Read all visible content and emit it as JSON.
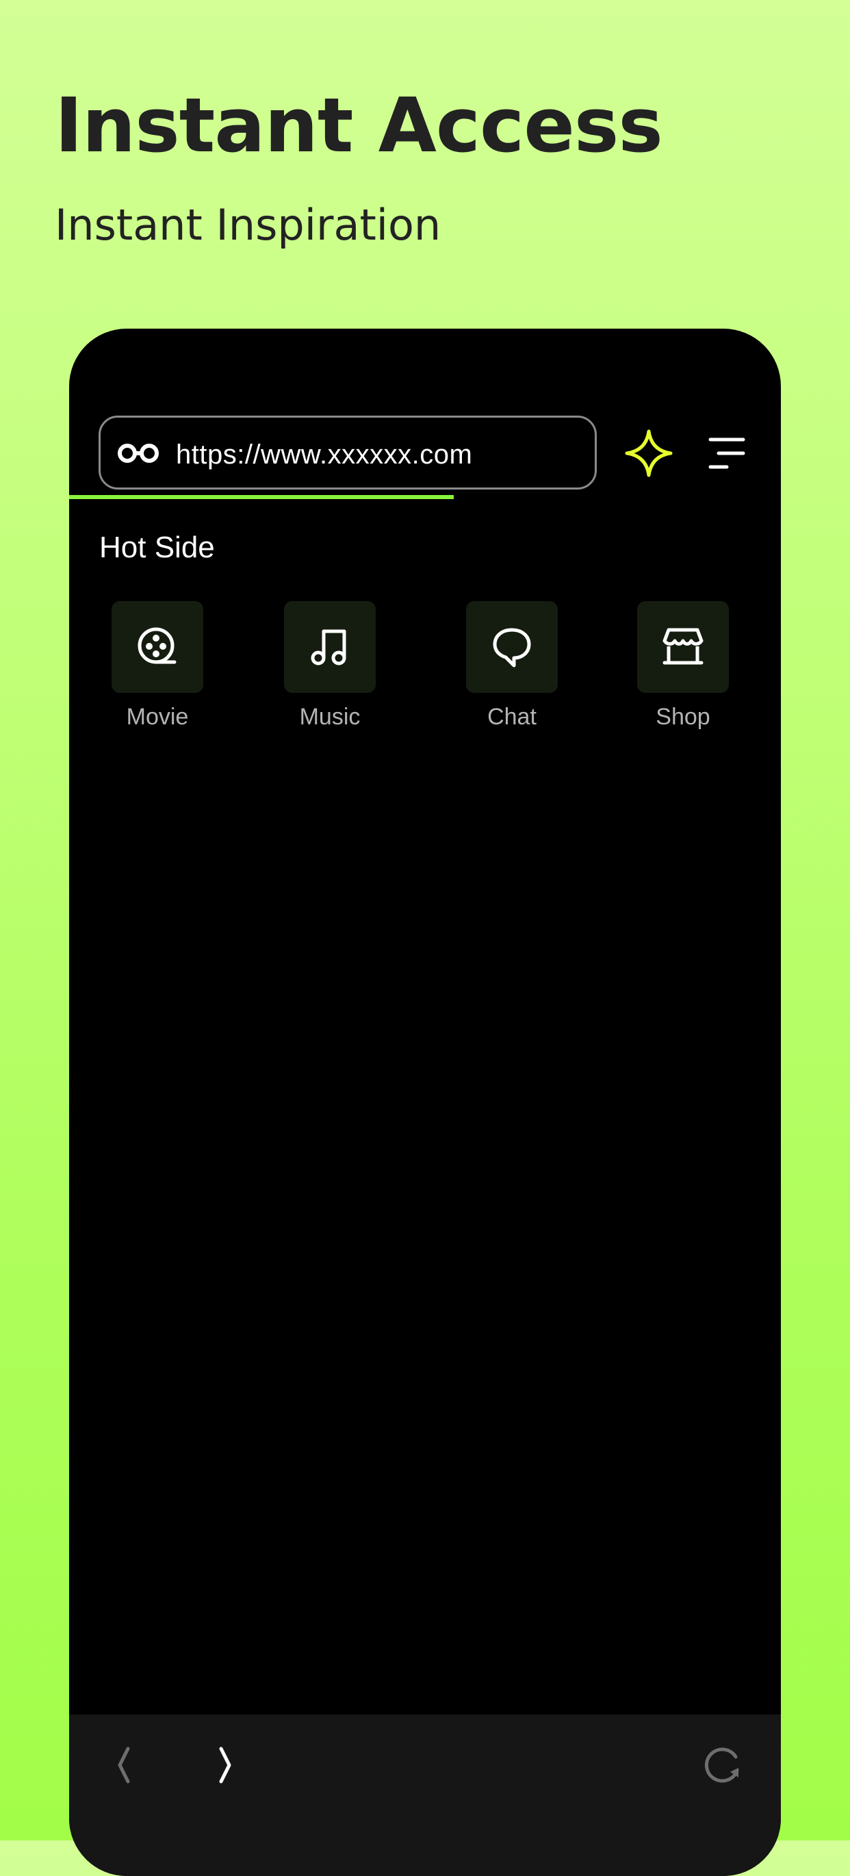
{
  "promo": {
    "headline": "Instant Access",
    "subheadline": "Instant Inspiration"
  },
  "browser": {
    "address_bar": {
      "url": "https://www.xxxxxx.com",
      "icon": "glasses-icon"
    },
    "toolbar_icons": [
      "sparkle-icon",
      "menu-lines-icon"
    ],
    "page_load_progress": 0.54,
    "hot_section": {
      "title": "Hot Side",
      "items": [
        {
          "label": "Movie",
          "icon": "film-reel-icon"
        },
        {
          "label": "Music",
          "icon": "music-note-icon"
        },
        {
          "label": "Chat",
          "icon": "chat-bubble-icon"
        },
        {
          "label": "Shop",
          "icon": "storefront-icon"
        }
      ]
    },
    "bottom_nav": {
      "icons": [
        "back-chevron-icon",
        "forward-chevron-icon",
        "reload-icon"
      ]
    }
  },
  "colors": {
    "background_top": "#d3ff96",
    "background_bottom": "#a2fd48",
    "accent_green": "#8bf33d",
    "sparkle_yellow": "#e6ff2e",
    "tile_background": "#151d10",
    "bottom_bar": "#161616"
  }
}
